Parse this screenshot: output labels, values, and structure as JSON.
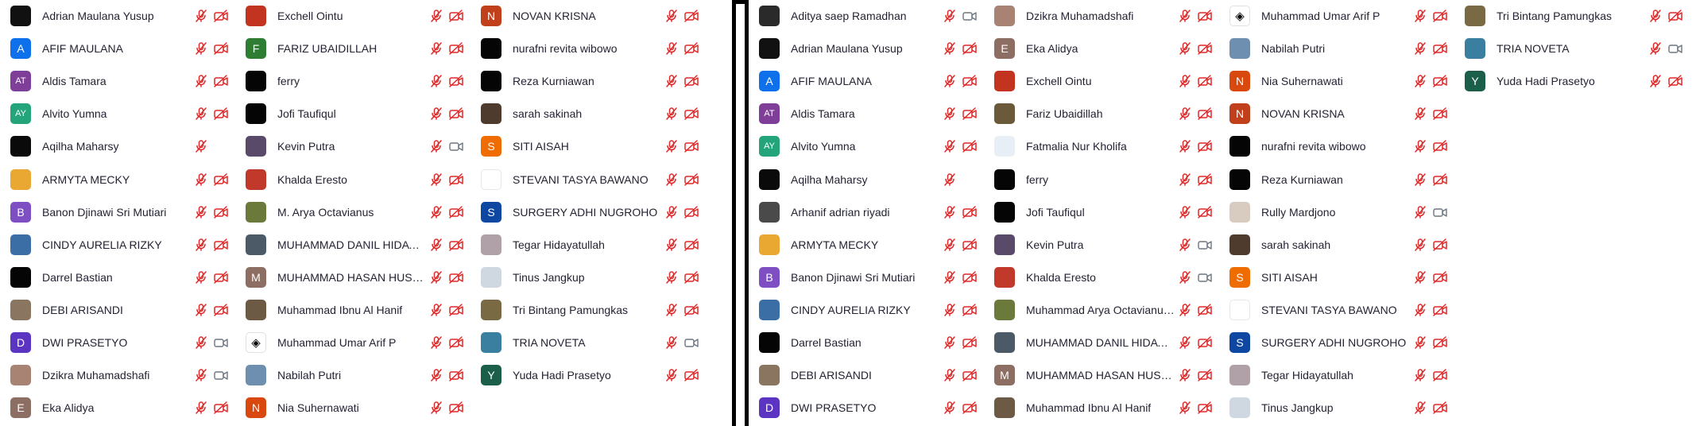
{
  "colors": {
    "muted_red": "#e02828",
    "icon_gray": "#6e7680",
    "divider": "#000000"
  },
  "left_panel": {
    "columns": [
      [
        {
          "name": "Adrian Maulana Yusup",
          "avatar": {
            "kind": "photo",
            "bg": "#111111"
          },
          "mic": "muted",
          "video": "off"
        },
        {
          "name": "AFIF MAULANA",
          "avatar": {
            "kind": "initial",
            "text": "A",
            "bg": "#0e71eb"
          },
          "mic": "muted",
          "video": "off"
        },
        {
          "name": "Aldis Tamara",
          "avatar": {
            "kind": "initial",
            "text": "AT",
            "bg": "#7f3f98"
          },
          "mic": "muted",
          "video": "off"
        },
        {
          "name": "Alvito Yumna",
          "avatar": {
            "kind": "initial",
            "text": "AY",
            "bg": "#23a47a"
          },
          "mic": "muted",
          "video": "off"
        },
        {
          "name": "Aqilha Maharsy",
          "avatar": {
            "kind": "photo",
            "bg": "#0a0a0a"
          },
          "mic": "muted",
          "video": "none"
        },
        {
          "name": "ARMYTA MECKY",
          "avatar": {
            "kind": "photo",
            "bg": "#e8a832"
          },
          "mic": "muted",
          "video": "off"
        },
        {
          "name": "Banon Djinawi Sri Mutiari",
          "avatar": {
            "kind": "initial",
            "text": "B",
            "bg": "#7d4fc3"
          },
          "mic": "muted",
          "video": "off"
        },
        {
          "name": "CINDY AURELIA RIZKY",
          "avatar": {
            "kind": "photo",
            "bg": "#3a6ea5"
          },
          "mic": "muted",
          "video": "off"
        },
        {
          "name": "Darrel Bastian",
          "avatar": {
            "kind": "photo",
            "bg": "#050505"
          },
          "mic": "muted",
          "video": "off"
        },
        {
          "name": "DEBI ARISANDI",
          "avatar": {
            "kind": "photo",
            "bg": "#8a7560"
          },
          "mic": "muted",
          "video": "off"
        },
        {
          "name": "DWI PRASETYO",
          "avatar": {
            "kind": "initial",
            "text": "D",
            "bg": "#5b34c2"
          },
          "mic": "muted",
          "video": "on"
        },
        {
          "name": "Dzikra Muhamadshafi",
          "avatar": {
            "kind": "photo",
            "bg": "#a88272"
          },
          "mic": "muted",
          "video": "on"
        },
        {
          "name": "Eka Alidya",
          "avatar": {
            "kind": "initial",
            "text": "E",
            "bg": "#8d6e63"
          },
          "mic": "muted",
          "video": "off"
        }
      ],
      [
        {
          "name": "Exchell Ointu",
          "avatar": {
            "kind": "photo",
            "bg": "#c2341f"
          },
          "mic": "muted",
          "video": "off"
        },
        {
          "name": "FARIZ UBAIDILLAH",
          "avatar": {
            "kind": "initial",
            "text": "F",
            "bg": "#2e7d32"
          },
          "mic": "muted",
          "video": "off"
        },
        {
          "name": "ferry",
          "avatar": {
            "kind": "photo",
            "bg": "#050505"
          },
          "mic": "muted",
          "video": "off"
        },
        {
          "name": "Jofi Taufiqul",
          "avatar": {
            "kind": "photo",
            "bg": "#050505"
          },
          "mic": "muted",
          "video": "off"
        },
        {
          "name": "Kevin Putra",
          "avatar": {
            "kind": "photo",
            "bg": "#5a4a6a"
          },
          "mic": "muted",
          "video": "on"
        },
        {
          "name": "Khalda Eresto",
          "avatar": {
            "kind": "photo",
            "bg": "#c0392b"
          },
          "mic": "muted",
          "video": "off"
        },
        {
          "name": "M. Arya Octavianus",
          "avatar": {
            "kind": "photo",
            "bg": "#6b7a3a"
          },
          "mic": "muted",
          "video": "off"
        },
        {
          "name": "MUHAMMAD DANIL HIDAYAT",
          "avatar": {
            "kind": "photo",
            "bg": "#4b5a66"
          },
          "mic": "muted",
          "video": "off"
        },
        {
          "name": "MUHAMMAD HASAN HUSEIN",
          "avatar": {
            "kind": "initial",
            "text": "M",
            "bg": "#8d6e63"
          },
          "mic": "muted",
          "video": "off"
        },
        {
          "name": "Muhammad Ibnu Al Hanif",
          "avatar": {
            "kind": "photo",
            "bg": "#6d5a44"
          },
          "mic": "muted",
          "video": "off"
        },
        {
          "name": "Muhammad Umar Arif P",
          "avatar": {
            "kind": "logo",
            "text": "◈"
          },
          "mic": "muted",
          "video": "off"
        },
        {
          "name": "Nabilah Putri",
          "avatar": {
            "kind": "photo",
            "bg": "#6f8fb0"
          },
          "mic": "muted",
          "video": "off"
        },
        {
          "name": "Nia Suhernawati",
          "avatar": {
            "kind": "initial",
            "text": "N",
            "bg": "#d9480f"
          },
          "mic": "muted",
          "video": "off"
        }
      ],
      [
        {
          "name": "NOVAN KRISNA",
          "avatar": {
            "kind": "initial",
            "text": "N",
            "bg": "#c1401b"
          },
          "mic": "muted",
          "video": "off"
        },
        {
          "name": "nurafni revita wibowo",
          "avatar": {
            "kind": "photo",
            "bg": "#050505"
          },
          "mic": "muted",
          "video": "off"
        },
        {
          "name": "Reza Kurniawan",
          "avatar": {
            "kind": "photo",
            "bg": "#050505"
          },
          "mic": "muted",
          "video": "off"
        },
        {
          "name": "sarah sakinah",
          "avatar": {
            "kind": "photo",
            "bg": "#4e3b2e"
          },
          "mic": "muted",
          "video": "off"
        },
        {
          "name": "SITI AISAH",
          "avatar": {
            "kind": "initial",
            "text": "S",
            "bg": "#ef6c00"
          },
          "mic": "muted",
          "video": "off"
        },
        {
          "name": "STEVANI TASYA BAWANO",
          "avatar": {
            "kind": "blank",
            "bg": "#ffffff"
          },
          "mic": "muted",
          "video": "off"
        },
        {
          "name": "SURGERY ADHI NUGROHO",
          "avatar": {
            "kind": "initial",
            "text": "S",
            "bg": "#0d47a1"
          },
          "mic": "muted",
          "video": "off"
        },
        {
          "name": "Tegar Hidayatullah",
          "avatar": {
            "kind": "photo",
            "bg": "#b0a0a8"
          },
          "mic": "muted",
          "video": "off"
        },
        {
          "name": "Tinus Jangkup",
          "avatar": {
            "kind": "photo",
            "bg": "#cfd8e0"
          },
          "mic": "muted",
          "video": "off"
        },
        {
          "name": "Tri Bintang Pamungkas",
          "avatar": {
            "kind": "photo",
            "bg": "#7a6a44"
          },
          "mic": "muted",
          "video": "off"
        },
        {
          "name": "TRIA NOVETA",
          "avatar": {
            "kind": "photo",
            "bg": "#3a7fa0"
          },
          "mic": "muted",
          "video": "on"
        },
        {
          "name": "Yuda Hadi Prasetyo",
          "avatar": {
            "kind": "initial",
            "text": "Y",
            "bg": "#1b5e4a"
          },
          "mic": "muted",
          "video": "off"
        }
      ]
    ]
  },
  "right_panel": {
    "columns": [
      [
        {
          "name": "Aditya saep Ramadhan",
          "avatar": {
            "kind": "photo",
            "bg": "#2a2a2a"
          },
          "mic": "muted",
          "video": "on"
        },
        {
          "name": "Adrian Maulana Yusup",
          "avatar": {
            "kind": "photo",
            "bg": "#111111"
          },
          "mic": "muted",
          "video": "off"
        },
        {
          "name": "AFIF MAULANA",
          "avatar": {
            "kind": "initial",
            "text": "A",
            "bg": "#0e71eb"
          },
          "mic": "muted",
          "video": "off"
        },
        {
          "name": "Aldis Tamara",
          "avatar": {
            "kind": "initial",
            "text": "AT",
            "bg": "#7f3f98"
          },
          "mic": "muted",
          "video": "off"
        },
        {
          "name": "Alvito Yumna",
          "avatar": {
            "kind": "initial",
            "text": "AY",
            "bg": "#23a47a"
          },
          "mic": "muted",
          "video": "off"
        },
        {
          "name": "Aqilha Maharsy",
          "avatar": {
            "kind": "photo",
            "bg": "#0a0a0a"
          },
          "mic": "muted",
          "video": "none"
        },
        {
          "name": "Arhanif adrian riyadi",
          "avatar": {
            "kind": "photo",
            "bg": "#4a4a4a"
          },
          "mic": "muted",
          "video": "off"
        },
        {
          "name": "ARMYTA MECKY",
          "avatar": {
            "kind": "photo",
            "bg": "#e8a832"
          },
          "mic": "muted",
          "video": "off"
        },
        {
          "name": "Banon Djinawi Sri Mutiari",
          "avatar": {
            "kind": "initial",
            "text": "B",
            "bg": "#7d4fc3"
          },
          "mic": "muted",
          "video": "off"
        },
        {
          "name": "CINDY AURELIA RIZKY",
          "avatar": {
            "kind": "photo",
            "bg": "#3a6ea5"
          },
          "mic": "muted",
          "video": "off"
        },
        {
          "name": "Darrel Bastian",
          "avatar": {
            "kind": "photo",
            "bg": "#050505"
          },
          "mic": "muted",
          "video": "off"
        },
        {
          "name": "DEBI ARISANDI",
          "avatar": {
            "kind": "photo",
            "bg": "#8a7560"
          },
          "mic": "muted",
          "video": "off"
        },
        {
          "name": "DWI PRASETYO",
          "avatar": {
            "kind": "initial",
            "text": "D",
            "bg": "#5b34c2"
          },
          "mic": "muted",
          "video": "off"
        }
      ],
      [
        {
          "name": "Dzikra Muhamadshafi",
          "avatar": {
            "kind": "photo",
            "bg": "#a88272"
          },
          "mic": "muted",
          "video": "off"
        },
        {
          "name": "Eka Alidya",
          "avatar": {
            "kind": "initial",
            "text": "E",
            "bg": "#8d6e63"
          },
          "mic": "muted",
          "video": "off"
        },
        {
          "name": "Exchell Ointu",
          "avatar": {
            "kind": "photo",
            "bg": "#c2341f"
          },
          "mic": "muted",
          "video": "off"
        },
        {
          "name": "Fariz Ubaidillah",
          "avatar": {
            "kind": "photo",
            "bg": "#6b5a3a"
          },
          "mic": "muted",
          "video": "off"
        },
        {
          "name": "Fatmalia Nur Kholifa",
          "avatar": {
            "kind": "photo",
            "bg": "#e8eef5"
          },
          "mic": "muted",
          "video": "off"
        },
        {
          "name": "ferry",
          "avatar": {
            "kind": "photo",
            "bg": "#050505"
          },
          "mic": "muted",
          "video": "off"
        },
        {
          "name": "Jofi Taufiqul",
          "avatar": {
            "kind": "photo",
            "bg": "#050505"
          },
          "mic": "muted",
          "video": "off"
        },
        {
          "name": "Kevin Putra",
          "avatar": {
            "kind": "photo",
            "bg": "#5a4a6a"
          },
          "mic": "muted",
          "video": "on"
        },
        {
          "name": "Khalda Eresto",
          "avatar": {
            "kind": "photo",
            "bg": "#c0392b"
          },
          "mic": "muted",
          "video": "on"
        },
        {
          "name": "Muhammad Arya Octavianus_IPA",
          "avatar": {
            "kind": "photo",
            "bg": "#6b7a3a"
          },
          "mic": "muted",
          "video": "off"
        },
        {
          "name": "MUHAMMAD DANIL HIDAYAT",
          "avatar": {
            "kind": "photo",
            "bg": "#4b5a66"
          },
          "mic": "muted",
          "video": "off"
        },
        {
          "name": "MUHAMMAD HASAN HUSEIN",
          "avatar": {
            "kind": "initial",
            "text": "M",
            "bg": "#8d6e63"
          },
          "mic": "muted",
          "video": "off"
        },
        {
          "name": "Muhammad Ibnu Al Hanif",
          "avatar": {
            "kind": "photo",
            "bg": "#6d5a44"
          },
          "mic": "muted",
          "video": "off"
        }
      ],
      [
        {
          "name": "Muhammad Umar Arif P",
          "avatar": {
            "kind": "logo",
            "text": "◈"
          },
          "mic": "muted",
          "video": "off"
        },
        {
          "name": "Nabilah Putri",
          "avatar": {
            "kind": "photo",
            "bg": "#6f8fb0"
          },
          "mic": "muted",
          "video": "off"
        },
        {
          "name": "Nia Suhernawati",
          "avatar": {
            "kind": "initial",
            "text": "N",
            "bg": "#d9480f"
          },
          "mic": "muted",
          "video": "off"
        },
        {
          "name": "NOVAN KRISNA",
          "avatar": {
            "kind": "initial",
            "text": "N",
            "bg": "#c1401b"
          },
          "mic": "muted",
          "video": "off"
        },
        {
          "name": "nurafni revita wibowo",
          "avatar": {
            "kind": "photo",
            "bg": "#050505"
          },
          "mic": "muted",
          "video": "off"
        },
        {
          "name": "Reza Kurniawan",
          "avatar": {
            "kind": "photo",
            "bg": "#050505"
          },
          "mic": "muted",
          "video": "off"
        },
        {
          "name": "Rully Mardjono",
          "avatar": {
            "kind": "photo",
            "bg": "#d8ccc0"
          },
          "mic": "muted",
          "video": "on"
        },
        {
          "name": "sarah sakinah",
          "avatar": {
            "kind": "photo",
            "bg": "#4e3b2e"
          },
          "mic": "muted",
          "video": "off"
        },
        {
          "name": "SITI AISAH",
          "avatar": {
            "kind": "initial",
            "text": "S",
            "bg": "#ef6c00"
          },
          "mic": "muted",
          "video": "off"
        },
        {
          "name": "STEVANI TASYA BAWANO",
          "avatar": {
            "kind": "blank",
            "bg": "#ffffff"
          },
          "mic": "muted",
          "video": "off"
        },
        {
          "name": "SURGERY ADHI NUGROHO",
          "avatar": {
            "kind": "initial",
            "text": "S",
            "bg": "#0d47a1"
          },
          "mic": "muted",
          "video": "off"
        },
        {
          "name": "Tegar Hidayatullah",
          "avatar": {
            "kind": "photo",
            "bg": "#b0a0a8"
          },
          "mic": "muted",
          "video": "off"
        },
        {
          "name": "Tinus Jangkup",
          "avatar": {
            "kind": "photo",
            "bg": "#cfd8e0"
          },
          "mic": "muted",
          "video": "off"
        }
      ],
      [
        {
          "name": "Tri Bintang Pamungkas",
          "avatar": {
            "kind": "photo",
            "bg": "#7a6a44"
          },
          "mic": "muted",
          "video": "off"
        },
        {
          "name": "TRIA NOVETA",
          "avatar": {
            "kind": "photo",
            "bg": "#3a7fa0"
          },
          "mic": "muted",
          "video": "on"
        },
        {
          "name": "Yuda Hadi Prasetyo",
          "avatar": {
            "kind": "initial",
            "text": "Y",
            "bg": "#1b5e4a"
          },
          "mic": "muted",
          "video": "off"
        }
      ]
    ]
  }
}
